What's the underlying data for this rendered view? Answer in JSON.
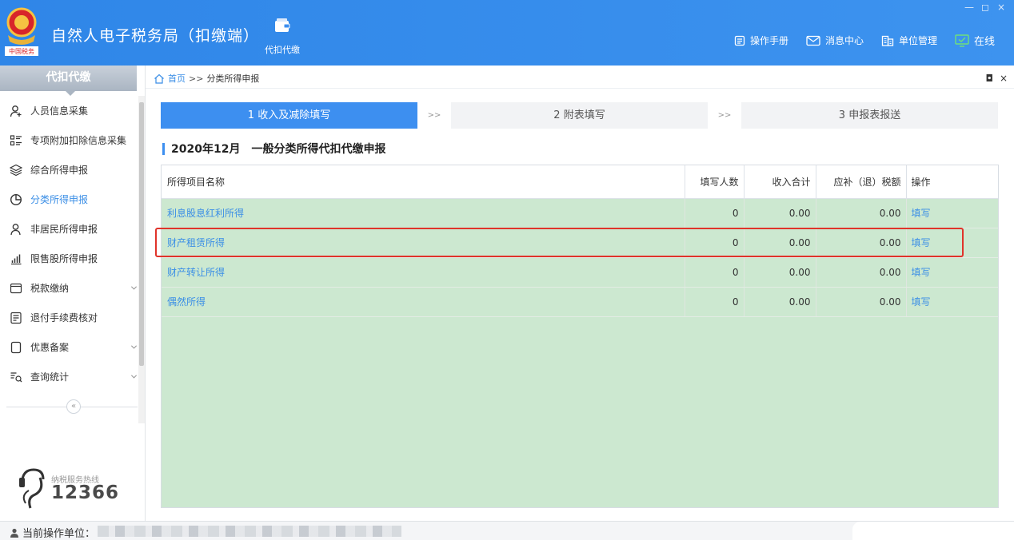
{
  "app": {
    "title": "自然人电子税务局（扣缴端）",
    "module_label": "代扣代缴",
    "header_links": [
      {
        "label": "操作手册",
        "icon": "manual-icon"
      },
      {
        "label": "消息中心",
        "icon": "mail-icon"
      },
      {
        "label": "单位管理",
        "icon": "building-icon"
      },
      {
        "label": "在线",
        "icon": "monitor-check-icon"
      }
    ],
    "window_controls": [
      "—",
      "◻",
      "×"
    ],
    "logo_text": "中国税务"
  },
  "sidebar": {
    "title": "代扣代缴",
    "items": [
      {
        "label": "人员信息采集",
        "icon": "person-add-icon",
        "active": false,
        "expandable": false
      },
      {
        "label": "专项附加扣除信息采集",
        "icon": "list-icon",
        "active": false,
        "expandable": false
      },
      {
        "label": "综合所得申报",
        "icon": "layers-icon",
        "active": false,
        "expandable": false
      },
      {
        "label": "分类所得申报",
        "icon": "pie-chart-icon",
        "active": true,
        "expandable": false
      },
      {
        "label": "非居民所得申报",
        "icon": "user-icon",
        "active": false,
        "expandable": false
      },
      {
        "label": "限售股所得申报",
        "icon": "bar-chart-icon",
        "active": false,
        "expandable": false
      },
      {
        "label": "税款缴纳",
        "icon": "folder-icon",
        "active": false,
        "expandable": true
      },
      {
        "label": "退付手续费核对",
        "icon": "document-icon",
        "active": false,
        "expandable": false
      },
      {
        "label": "优惠备案",
        "icon": "file-icon",
        "active": false,
        "expandable": true
      },
      {
        "label": "查询统计",
        "icon": "search-list-icon",
        "active": false,
        "expandable": true
      }
    ],
    "collapse_symbol": "«",
    "hotline_caption": "纳税服务热线",
    "hotline_number": "12366"
  },
  "breadcrumb": {
    "home": "首页",
    "separator": ">>",
    "current": "分类所得申报"
  },
  "pane_controls": [
    "◘",
    "×"
  ],
  "steps": [
    {
      "label": "1 收入及减除填写",
      "active": true
    },
    {
      "label": "2 附表填写",
      "active": false
    },
    {
      "label": "3 申报表报送",
      "active": false
    }
  ],
  "step_separator": ">>",
  "section": {
    "period": "2020年12月",
    "title": "一般分类所得代扣代缴申报"
  },
  "table": {
    "columns": [
      "所得项目名称",
      "填写人数",
      "收入合计",
      "应补（退）税额",
      "操作"
    ],
    "rows": [
      {
        "name": "利息股息红利所得",
        "count": "0",
        "income": "0.00",
        "tax": "0.00",
        "action": "填写"
      },
      {
        "name": "财产租赁所得",
        "count": "0",
        "income": "0.00",
        "tax": "0.00",
        "action": "填写"
      },
      {
        "name": "财产转让所得",
        "count": "0",
        "income": "0.00",
        "tax": "0.00",
        "action": "填写"
      },
      {
        "name": "偶然所得",
        "count": "0",
        "income": "0.00",
        "tax": "0.00",
        "action": "填写"
      }
    ],
    "highlighted_row": 1
  },
  "status": {
    "label": "当前操作单位："
  },
  "colors": {
    "header_blue": "#3d8ff0",
    "link_blue": "#3a8ee6",
    "table_green": "#cce8d0",
    "highlight_red": "#e0332a"
  }
}
